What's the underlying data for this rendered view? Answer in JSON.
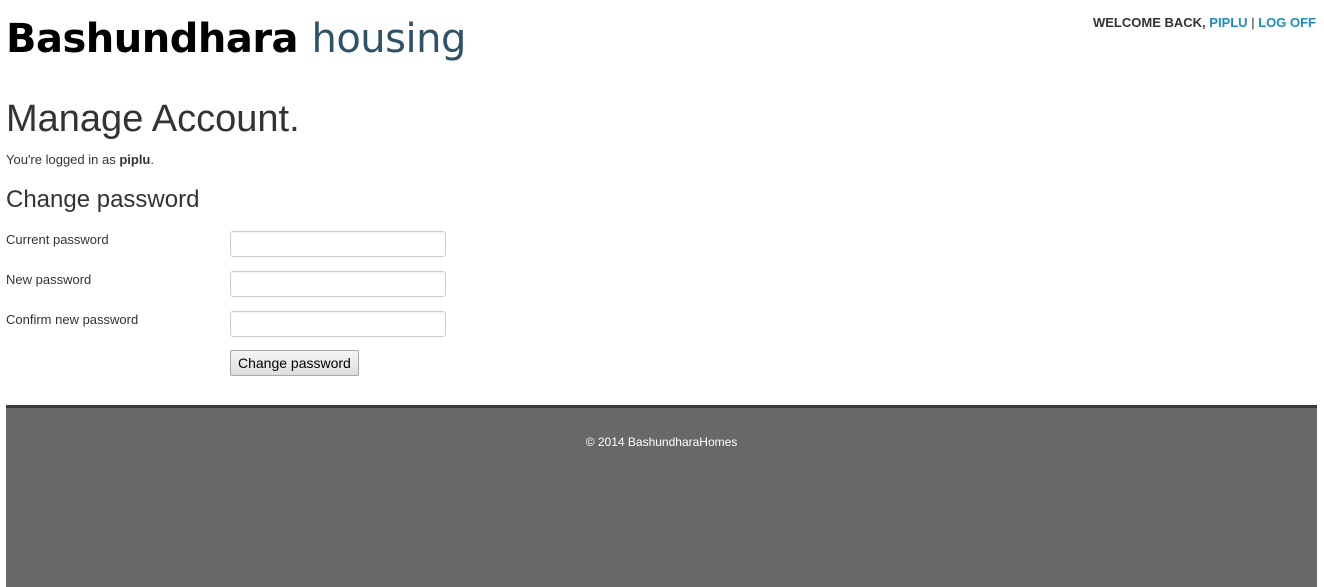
{
  "header": {
    "site_title_main": "Bashundhara",
    "site_title_accent": "housing",
    "welcome_prefix": "WELCOME BACK,",
    "username": "PIPLU",
    "separator": "|",
    "logoff_label": "LOG OFF"
  },
  "main": {
    "heading": "Manage Account.",
    "logged_in_prefix": "You're logged in as",
    "logged_in_user": "piplu",
    "logged_in_suffix": ".",
    "section_heading": "Change password",
    "fields": {
      "current": {
        "label": "Current password",
        "value": "",
        "placeholder": ""
      },
      "new": {
        "label": "New password",
        "value": "",
        "placeholder": ""
      },
      "confirm": {
        "label": "Confirm new password",
        "value": "",
        "placeholder": ""
      }
    },
    "submit_label": "Change password"
  },
  "footer": {
    "copyright": "© 2014 BashundharaHomes"
  },
  "colors": {
    "title_accent": "#2e5368",
    "link": "#1a8ec2",
    "footer_bg": "#686868",
    "footer_border": "#3a3a3a",
    "text": "#333333"
  }
}
